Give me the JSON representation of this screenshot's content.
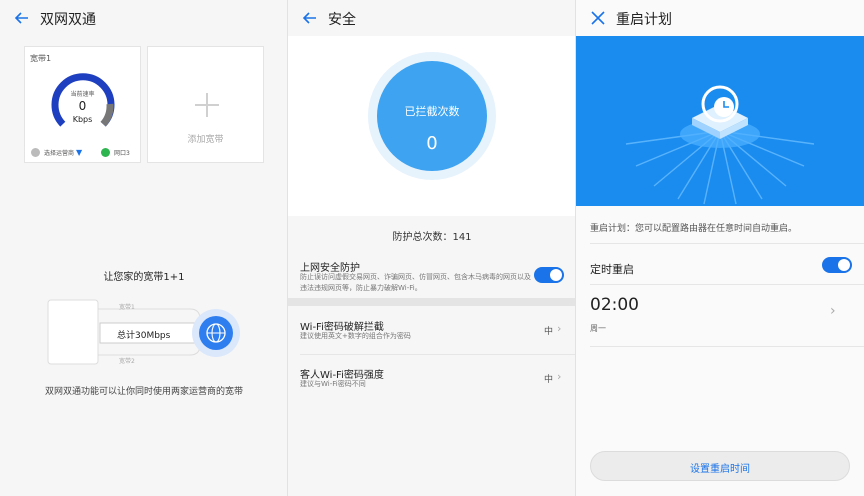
{
  "panel1": {
    "title": "双网双通",
    "card1_label": "宽带1",
    "gauge_caption": "当前速率",
    "gauge_value": "0",
    "gauge_unit": "Kbps",
    "operator_select": "选择运营商",
    "port_label": "网口3",
    "add_label": "添加宽带",
    "promo_title": "让您家的宽带1+1",
    "line1_label": "宽带1",
    "line2_label": "宽带2",
    "total_label": "总计30Mbps",
    "description": "双网双通功能可以让你同时使用两家运营商的宽带",
    "gauge_level": 0.0
  },
  "panel2": {
    "title": "安全",
    "circle_title": "已拦截次数",
    "circle_value": "0",
    "total_text": "防护总次数：141",
    "items": [
      {
        "title": "上网安全防护",
        "sub": "防止误访问虚假交易网页、诈骗网页、仿冒网页、包含木马病毒的网页以及违法违规网页等，防止暴力破解Wi-Fi。",
        "toggle_on": true
      },
      {
        "title": "Wi-Fi密码破解拦截",
        "sub": "建议使用英文+数字的组合作为密码",
        "level": "中"
      },
      {
        "title": "客人Wi-Fi密码强度",
        "sub": "建议与Wi-Fi密码不同",
        "level": "中"
      }
    ]
  },
  "panel3": {
    "title": "重启计划",
    "description": "重启计划：您可以配置路由器在任意时间自动重启。",
    "timed_label": "定时重启",
    "timed_on": true,
    "time": "02:00",
    "weekday": "周一",
    "set_button": "设置重启时间"
  },
  "colors": {
    "accent": "#1a73e8",
    "banner": "#1a8cf0",
    "circle": "#3ea3f0"
  }
}
